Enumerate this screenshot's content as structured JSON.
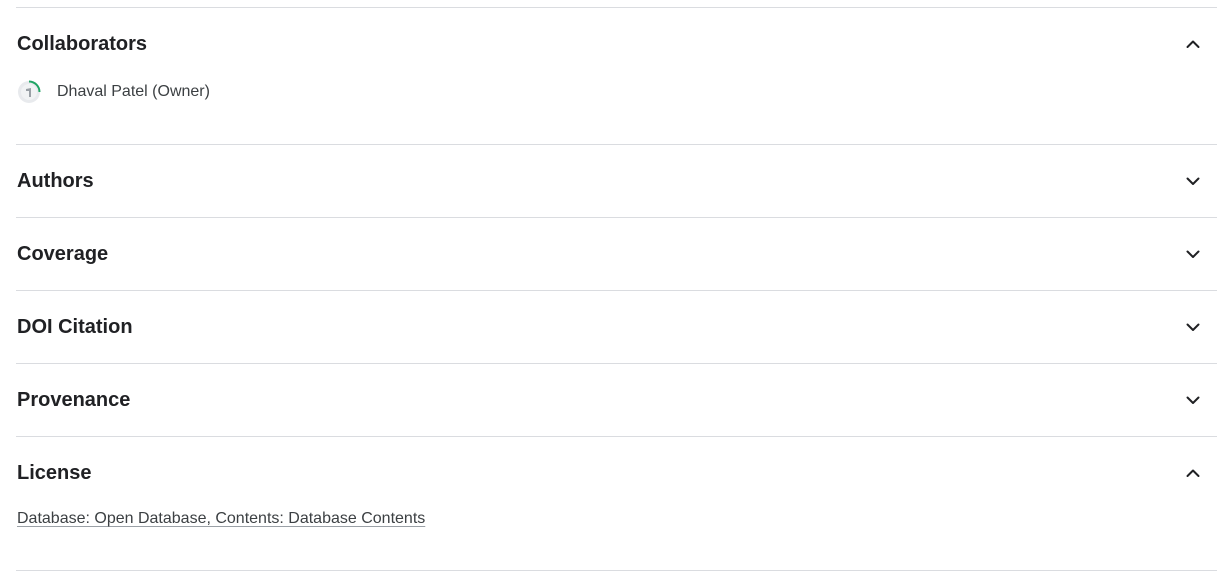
{
  "sections": [
    {
      "title": "Collaborators",
      "expanded": true,
      "chevron_icon": "chevron-up-icon"
    },
    {
      "title": "Authors",
      "expanded": false,
      "chevron_icon": "chevron-down-icon"
    },
    {
      "title": "Coverage",
      "expanded": false,
      "chevron_icon": "chevron-down-icon"
    },
    {
      "title": "DOI Citation",
      "expanded": false,
      "chevron_icon": "chevron-down-icon"
    },
    {
      "title": "Provenance",
      "expanded": false,
      "chevron_icon": "chevron-down-icon"
    },
    {
      "title": "License",
      "expanded": true,
      "chevron_icon": "chevron-up-icon"
    }
  ],
  "collaborators": [
    {
      "name": "Dhaval Patel (Owner)",
      "avatar_icon": "user-avatar-icon"
    }
  ],
  "license": {
    "text": "Database: Open Database, Contents: Database Contents"
  },
  "colors": {
    "text": "#202124",
    "divider": "#dadce0",
    "avatar_ring": "#20a464"
  }
}
